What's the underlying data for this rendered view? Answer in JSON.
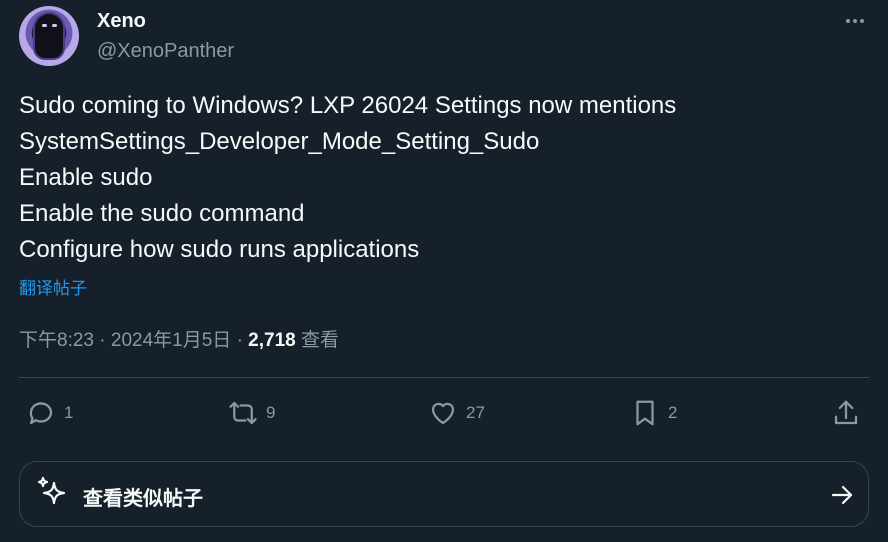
{
  "author": {
    "name": "Xeno",
    "handle": "@XenoPanther"
  },
  "tweet": {
    "lines": [
      "Sudo coming to Windows? LXP 26024 Settings now mentions",
      "SystemSettings_Developer_Mode_Setting_Sudo",
      "Enable sudo",
      "Enable the sudo command",
      "Configure how sudo runs applications"
    ],
    "translate_link": "翻译帖子",
    "time": "下午8:23",
    "date": "2024年1月5日",
    "separator": "·",
    "views": "2,718",
    "views_label": "查看"
  },
  "actions": {
    "reply": {
      "icon": "reply-icon",
      "count": "1"
    },
    "retweet": {
      "icon": "retweet-icon",
      "count": "9"
    },
    "like": {
      "icon": "heart-icon",
      "count": "27"
    },
    "bookmark": {
      "icon": "bookmark-icon",
      "count": "2"
    },
    "share": {
      "icon": "share-icon"
    }
  },
  "similar_posts": {
    "label": "查看类似帖子",
    "icon": "sparkle-icon",
    "arrow_icon": "arrow-right-icon"
  },
  "colors": {
    "background": "#15202b",
    "text": "#f7f9f9",
    "secondary": "#8b98a5",
    "link": "#1d9bf0",
    "border": "#38444d"
  }
}
